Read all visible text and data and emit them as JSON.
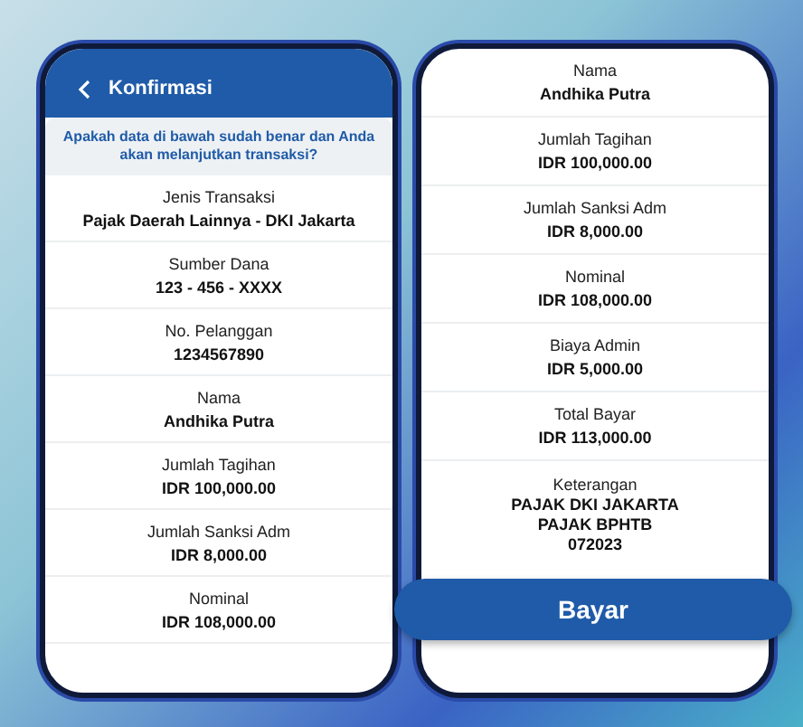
{
  "left_screen": {
    "title": "Konfirmasi",
    "prompt": "Apakah data di bawah sudah benar dan Anda akan melanjutkan transaksi?",
    "rows": [
      {
        "label": "Jenis Transaksi",
        "values": [
          "Pajak Daerah Lainnya - DKI Jakarta"
        ]
      },
      {
        "label": "Sumber Dana",
        "values": [
          "123 - 456 - XXXX"
        ]
      },
      {
        "label": "No. Pelanggan",
        "values": [
          "1234567890"
        ]
      },
      {
        "label": "Nama",
        "values": [
          "Andhika Putra"
        ]
      },
      {
        "label": "Jumlah Tagihan",
        "values": [
          "IDR 100,000.00"
        ]
      },
      {
        "label": "Jumlah Sanksi Adm",
        "values": [
          "IDR 8,000.00"
        ]
      },
      {
        "label": "Nominal",
        "values": [
          "IDR 108,000.00"
        ]
      }
    ]
  },
  "right_screen": {
    "rows": [
      {
        "label": "Nama",
        "values": [
          "Andhika Putra"
        ]
      },
      {
        "label": "Jumlah Tagihan",
        "values": [
          "IDR 100,000.00"
        ]
      },
      {
        "label": "Jumlah Sanksi Adm",
        "values": [
          "IDR 8,000.00"
        ]
      },
      {
        "label": "Nominal",
        "values": [
          "IDR 108,000.00"
        ]
      },
      {
        "label": "Biaya Admin",
        "values": [
          "IDR 5,000.00"
        ]
      },
      {
        "label": "Total Bayar",
        "values": [
          "IDR 113,000.00"
        ]
      },
      {
        "label": "Keterangan",
        "values": [
          "PAJAK DKI JAKARTA",
          "PAJAK BPHTB",
          "072023"
        ]
      }
    ],
    "pay_button": "Bayar"
  }
}
